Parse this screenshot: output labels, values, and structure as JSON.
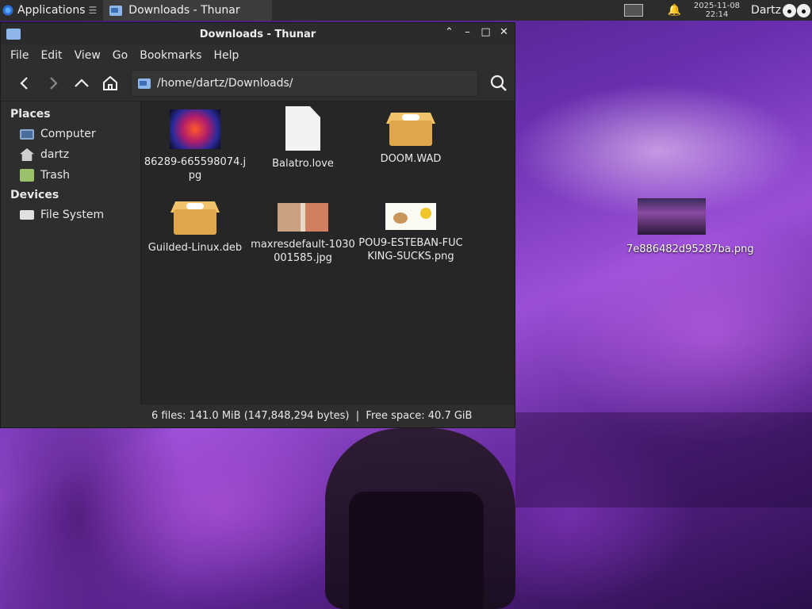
{
  "panel": {
    "applications": "Applications",
    "separator": "☰",
    "task_label": "Downloads - Thunar",
    "date": "2025-11-08",
    "time": "22:14",
    "user": "Dartz"
  },
  "window": {
    "title": "Downloads - Thunar",
    "menu": [
      "File",
      "Edit",
      "View",
      "Go",
      "Bookmarks",
      "Help"
    ],
    "location": "/home/dartz/Downloads/",
    "sidebar": {
      "places_header": "Places",
      "places": [
        "Computer",
        "dartz",
        "Trash"
      ],
      "devices_header": "Devices",
      "devices": [
        "File System"
      ]
    },
    "files": [
      {
        "name": "86289-665598074.jpg",
        "icon": "image-thumbnail"
      },
      {
        "name": "Balatro.love",
        "icon": "document-icon"
      },
      {
        "name": "DOOM.WAD",
        "icon": "package-icon"
      },
      {
        "name": "Guilded-Linux.deb",
        "icon": "package-icon"
      },
      {
        "name": "maxresdefault-1030001585.jpg",
        "icon": "image-thumbnail"
      },
      {
        "name": "POU9-ESTEBAN-FUCKING-SUCKS.png",
        "icon": "image-thumbnail"
      }
    ],
    "status": "6 files: 141.0 MiB (147,848,294 bytes)  |  Free space: 40.7 GiB"
  },
  "desktop": {
    "icon_label": "7e886482d95287ba.png"
  }
}
